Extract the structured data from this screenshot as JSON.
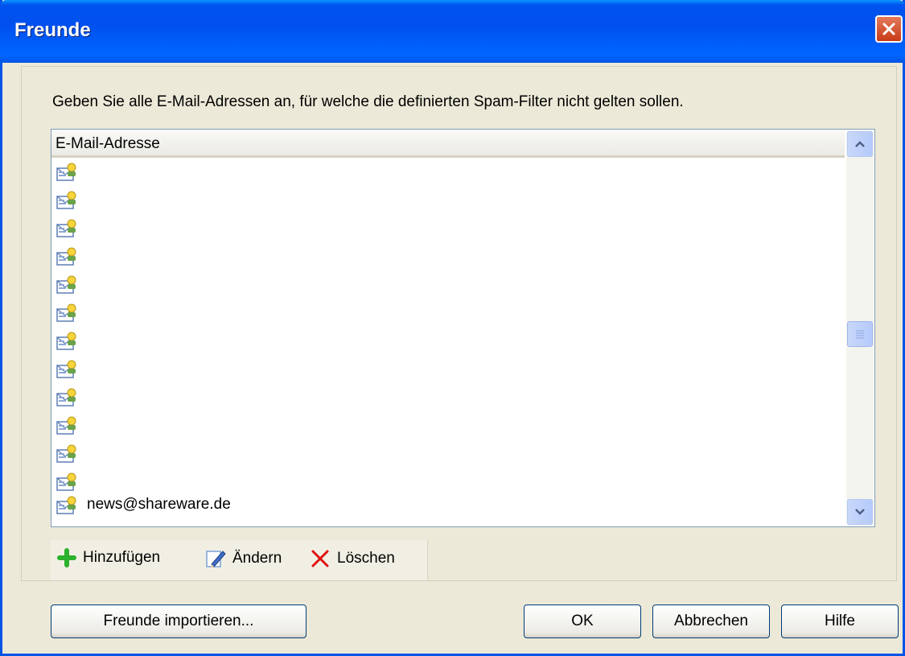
{
  "window": {
    "title": "Freunde"
  },
  "instruction": "Geben Sie alle E-Mail-Adressen an, für welche die definierten Spam-Filter nicht gelten sollen.",
  "list": {
    "header": "E-Mail-Adresse",
    "rows": [
      "",
      "",
      "",
      "",
      "",
      "",
      "",
      "",
      "",
      "",
      "",
      "",
      "news@shareware.de"
    ]
  },
  "toolbar": {
    "add": "Hinzufügen",
    "edit": "Ändern",
    "delete": "Löschen"
  },
  "buttons": {
    "import": "Freunde importieren...",
    "ok": "OK",
    "cancel": "Abbrechen",
    "help": "Hilfe"
  },
  "colors": {
    "titlebar": "#0054e3",
    "dialog_bg": "#ece9d8",
    "close": "#c83a18",
    "add_icon": "#2bb12b",
    "delete_icon": "#e01010"
  },
  "icons": {
    "row": "mail-contact-icon",
    "add": "plus-icon",
    "edit": "pencil-icon",
    "delete": "x-icon",
    "close": "close-icon"
  }
}
